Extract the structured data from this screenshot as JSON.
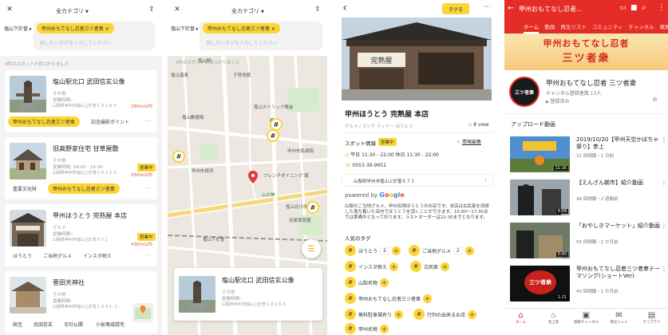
{
  "p1": {
    "header": {
      "close": "✕",
      "category": "全カテゴリ",
      "share": "⇪"
    },
    "area": "塩山下於曽",
    "active_tag": "甲州おもてなし忍者三ツ者衆",
    "search_placeholder": "探したいタグを入力してください",
    "count": "4件のスポットが見つかりました",
    "spots": [
      {
        "name": "塩山駅北口 武田信玄公像",
        "cat": "その他",
        "hours": "営業時間:-",
        "addr": "山梨県甲州市塩山上於曽１９１８-5",
        "dist": "289m以内",
        "badge": "",
        "tags": [
          "甲州おもてなし忍者三ツ者衆",
          "記念撮影ポイント"
        ]
      },
      {
        "name": "旧高野家住宅 甘草屋敷",
        "cat": "その他",
        "hours": "営業時間: 09:00 - 16:30",
        "addr": "山梨県甲州市塩山上於曽１６３１-1",
        "dist": "350m以内",
        "badge": "営業中",
        "tags": [
          "重要文化財",
          "甲州おもてなし忍者三ツ者衆"
        ]
      },
      {
        "name": "甲州ほうとう 完熟屋 本店",
        "cat": "グルメ",
        "hours": "営業時間:-",
        "addr": "山梨県甲州市塩山上於曽６７１",
        "dist": "430m以内",
        "badge": "営業中",
        "tags": [
          "ほうとう",
          "ご当地グルメ",
          "インスタ映え"
        ]
      },
      {
        "name": "菅田天神社",
        "cat": "その他",
        "hours": "営業時間:-",
        "addr": "山梨県甲州市塩山上於曽１０４１-２",
        "dist": "",
        "badge": "",
        "tags": [
          "国宝",
          "武田信玄",
          "寺社仏閣",
          "小桜韋威鎧兜"
        ]
      }
    ]
  },
  "p2": {
    "header": {
      "close": "✕",
      "category": "全カテゴリ",
      "share": "⇪"
    },
    "area": "塩山下於曽",
    "active_tag": "甲州おもてなし忍者三ツ者衆",
    "search_placeholder": "探したいタグを入力してください",
    "count": "4件のスポットが見つかりました",
    "map_labels": [
      "塩山温泉",
      "子育地蔵",
      "塩山カトリック教会",
      "塩山郵便局",
      "甲州市役所",
      "フレンチダイニング 蔵",
      "山の神",
      "塩山北小学校",
      "赤尾保育園",
      "塩山下於曽",
      "甲州市民病院",
      "塩山駅"
    ],
    "card": {
      "name": "塩山駅北口 武田信玄公像",
      "cat": "その他",
      "hours": "営業時間:-",
      "addr": "山梨県甲州市塩山上於曽１９１８-5"
    }
  },
  "p3": {
    "back": "‹",
    "tag_btn": "タグる",
    "more": "⋯",
    "title": "甲州ほうとう 完熟屋 本店",
    "subcats": "グルメ / ランチ ディナー ほうとう",
    "views": "8 view",
    "info_label": "スポット情報",
    "badge": "営業中",
    "edit": "情報編集",
    "hours": "平日 11:30 - 22:00 休日 11:30 - 22:00",
    "phone": "0553-39-9651",
    "address": "山梨県甲州市塩山上於曽６７１",
    "powered": "powered by",
    "google": [
      "G",
      "o",
      "o",
      "g",
      "l",
      "e"
    ],
    "google_colors": [
      "#4285f4",
      "#ea4335",
      "#fbbc05",
      "#4285f4",
      "#34a853",
      "#ea4335"
    ],
    "desc": "山梨のご当地グルメ、甲州名物ほうとうのお店です。本店は古民家を改修した落ち着いた店内でほうとうを頂くことができます。15:00〜17:30までは準備中となっております。ラストオーダーは21:30までとなります。",
    "popular": "人気のタグ",
    "ptags": [
      {
        "label": "ほうとう",
        "count": "2"
      },
      {
        "label": "ご当地グルメ",
        "count": "2"
      },
      {
        "label": "インスタ映え",
        "count": ""
      },
      {
        "label": "古民家",
        "count": ""
      },
      {
        "label": "山梨名物",
        "count": ""
      },
      {
        "label": "甲州おもてなし忍者三ツ者衆",
        "count": ""
      },
      {
        "label": "無料駐車場有り",
        "count": ""
      },
      {
        "label": "行列の出来るお店",
        "count": ""
      },
      {
        "label": "甲州名物",
        "count": ""
      }
    ]
  },
  "p4": {
    "title": "甲州おもてなし忍者...",
    "tabs": [
      "ホーム",
      "動画",
      "再生リスト",
      "コミュニティ",
      "チャンネル",
      "概要"
    ],
    "banner": [
      "甲州おもてなし忍者",
      "三ツ者衆"
    ],
    "channel_name": "甲州おもてなし忍者 三ツ者衆",
    "subs": "チャンネル登録者数 13人",
    "subscribed": "登録済み",
    "uploads": "アップロード動画",
    "avatar_text": "三ツ者衆",
    "videos": [
      {
        "title": "2019/10/20【甲州天空かぼちゃ祭り】参上",
        "meta": "31 回視聴・1 日前",
        "dur": "11:16"
      },
      {
        "title": "【えんざん朝市】紹介動画",
        "meta": "48 回視聴・2 週間前",
        "dur": "8:04"
      },
      {
        "title": "「おやしきマーケット」紹介動画",
        "meta": "55 回視聴・1 か月前",
        "dur": "5:40"
      },
      {
        "title": "甲州おもてなし忍者三ツ者衆テーマソング(ショートVer)",
        "meta": "40 回視聴・1 か月前",
        "dur": "1:21"
      }
    ],
    "thumb4_text": "三ツ者衆",
    "nav": [
      "ホーム",
      "急上昇",
      "登録チャンネル",
      "受信トレイ",
      "ライブラリ"
    ],
    "colors": {
      "red": "#e52d27",
      "yellow": "#fcd535"
    }
  }
}
